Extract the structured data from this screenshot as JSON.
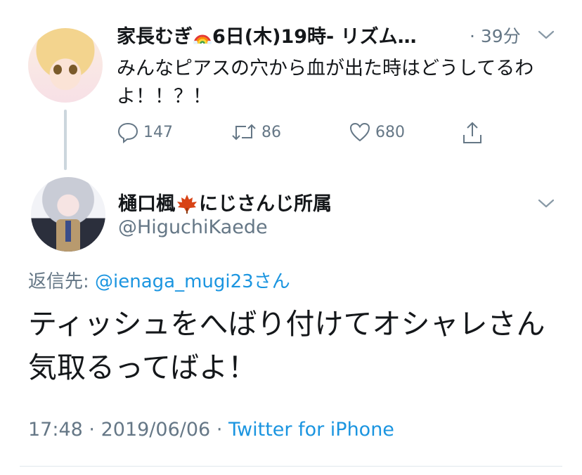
{
  "parent_tweet": {
    "display_name_prefix": "家長むぎ",
    "display_name_suffix": "6日(木)19時- リズム…",
    "time": "· 39分",
    "text": "みんなピアスの穴から血が出た時はどうしてるわよ！！？！",
    "reply_count": "147",
    "retweet_count": "86",
    "like_count": "680"
  },
  "reply_tweet": {
    "display_name_prefix": "樋口楓",
    "display_name_suffix": "にじさんじ所属",
    "handle": "@HiguchiKaede",
    "reply_to_label": "返信先:",
    "reply_to_mention": "@ienaga_mugi23さん",
    "text": "ティッシュをへばり付けてオシャレさん気取るってばよ！",
    "time": "17:48",
    "date": "2019/06/06",
    "source": "Twitter for iPhone",
    "separator": "·"
  },
  "icons": {
    "reply": "reply-icon",
    "retweet": "retweet-icon",
    "like": "heart-icon",
    "share": "share-icon",
    "caret": "chevron-down-icon",
    "emoji1": "rainbow-emoji",
    "emoji2": "maple-leaf-emoji"
  },
  "colors": {
    "link": "#1b95e0",
    "muted": "#657786",
    "text": "#14171a",
    "thread_line": "#ccd6dd"
  }
}
